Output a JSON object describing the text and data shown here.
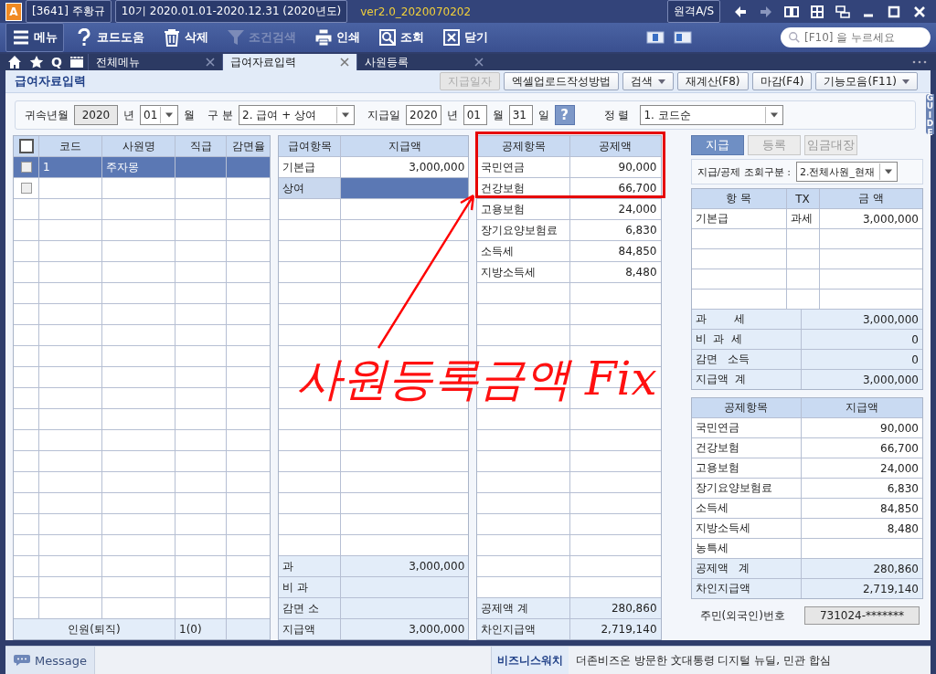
{
  "title_bar": {
    "app_badge": "A",
    "company": "[3641] 주황규",
    "period": "10기  2020.01.01-2020.12.31  (2020년도)",
    "version": "ver2.0_2020070202",
    "remote": "원격A/S"
  },
  "toolbar": {
    "items": [
      {
        "kind": "menu",
        "label": "메뉴",
        "disabled": false
      },
      {
        "kind": "help",
        "label": "코드도움",
        "disabled": false
      },
      {
        "kind": "trash",
        "label": "삭제",
        "disabled": false
      },
      {
        "kind": "filter",
        "label": "조건검색",
        "disabled": true
      },
      {
        "kind": "print",
        "label": "인쇄",
        "disabled": false
      },
      {
        "kind": "search",
        "label": "조회",
        "disabled": false
      },
      {
        "kind": "close",
        "label": "닫기",
        "disabled": false
      }
    ],
    "search_placeholder": "[F10] 을 누르세요"
  },
  "tab_bar": {
    "quick": "Q",
    "tabs": [
      {
        "label": "전체메뉴",
        "selected": false
      },
      {
        "label": "급여자료입력",
        "selected": true
      },
      {
        "label": "사원등록",
        "selected": false
      }
    ]
  },
  "page": {
    "title": "급여자료입력",
    "actions": [
      {
        "label": "지급일자",
        "disabled": true,
        "dropdown": false
      },
      {
        "label": "엑셀업로드작성방법",
        "disabled": false,
        "dropdown": false
      },
      {
        "label": "검색",
        "disabled": false,
        "dropdown": true
      },
      {
        "label": "재계산(F8)",
        "disabled": false,
        "dropdown": false
      },
      {
        "label": "마감(F4)",
        "disabled": false,
        "dropdown": false
      },
      {
        "label": "기능모음(F11)",
        "disabled": false,
        "dropdown": true
      }
    ],
    "guide": "GUIDE"
  },
  "filters": {
    "period_label": "귀속년월",
    "year": "2020",
    "year_unit": "년",
    "month": "01",
    "month_unit": "월",
    "type_label": "구 분",
    "type": "2. 급여 + 상여",
    "pay_date_label": "지급일",
    "pay_year": "2020",
    "pay_year_unit": "년",
    "pay_month": "01",
    "pay_month_unit": "월",
    "pay_day": "31",
    "pay_day_unit": "일",
    "help": "?",
    "sort_label": "정 렬",
    "sort": "1. 코드순"
  },
  "employees": {
    "columns": [
      "코드",
      "사원명",
      "직급",
      "감면율"
    ],
    "all_checked": false,
    "rows": [
      {
        "code": "1",
        "name": "주자몽",
        "checked": false,
        "selected": true
      }
    ],
    "new_row_checked": false,
    "footer_label": "인원(퇴직)",
    "footer_value": "1(0)"
  },
  "pay_items": {
    "columns": [
      "급여항목",
      "지급액"
    ],
    "rows": [
      {
        "label": "기본급",
        "amount": "3,000,000",
        "selected": false
      },
      {
        "label": "상여",
        "selected": true
      }
    ],
    "totals": [
      {
        "label": "과",
        "amount": "3,000,000"
      },
      {
        "label": "비 과"
      },
      {
        "label": "감면 소"
      },
      {
        "label": "지급액",
        "amount": "3,000,000"
      }
    ]
  },
  "deductions": {
    "columns": [
      "공제항목",
      "공제액"
    ],
    "rows": [
      {
        "label": "국민연금",
        "amount": "90,000"
      },
      {
        "label": "건강보험",
        "amount": "66,700"
      },
      {
        "label": "고용보험",
        "amount": "24,000"
      },
      {
        "label": "장기요양보험료",
        "amount": "6,830"
      },
      {
        "label": "소득세",
        "amount": "84,850"
      },
      {
        "label": "지방소득세",
        "amount": "8,480"
      }
    ],
    "totals": [
      {
        "label": "공제액 계",
        "amount": "280,860"
      },
      {
        "label": "차인지급액",
        "amount": "2,719,140"
      }
    ]
  },
  "annotation": {
    "note": "사원등록금액 Fix"
  },
  "summary": {
    "tabs": [
      {
        "label": "지급",
        "selected": true
      },
      {
        "label": "등록",
        "selected": false
      },
      {
        "label": "임금대장",
        "selected": false
      }
    ],
    "filter_label": "지급/공제 조회구분 :",
    "filter_value": "2.전체사원_현재",
    "pay_table": {
      "columns": [
        "항 목",
        "TX",
        "금 액"
      ],
      "rows": [
        {
          "item": "기본급",
          "tx": "과세",
          "amount": "3,000,000"
        }
      ],
      "totals": [
        {
          "label": "과        세",
          "amount": "3,000,000"
        },
        {
          "label": "비  과  세",
          "amount": "0"
        },
        {
          "label": "감면   소득",
          "amount": "0"
        },
        {
          "label": "지급액  계",
          "amount": "3,000,000"
        }
      ]
    },
    "deduction_table": {
      "columns": [
        "공제항목",
        "지급액"
      ],
      "rows": [
        {
          "label": "국민연금",
          "amount": "90,000"
        },
        {
          "label": "건강보험",
          "amount": "66,700"
        },
        {
          "label": "고용보험",
          "amount": "24,000"
        },
        {
          "label": "장기요양보험료",
          "amount": "6,830"
        },
        {
          "label": "소득세",
          "amount": "84,850"
        },
        {
          "label": "지방소득세",
          "amount": "8,480"
        },
        {
          "label": "농특세"
        }
      ],
      "totals": [
        {
          "label": "공제액   계",
          "amount": "280,860"
        },
        {
          "label": "차인지급액",
          "amount": "2,719,140"
        }
      ]
    },
    "id_label": "주민(외국인)번호",
    "id_value": "731024-*******"
  },
  "status_bar": {
    "message": "Message",
    "news_label": "비즈니스워치",
    "news": "더존비즈온  방문한 文대통령 디지털 뉴딜, 민관 합심"
  }
}
